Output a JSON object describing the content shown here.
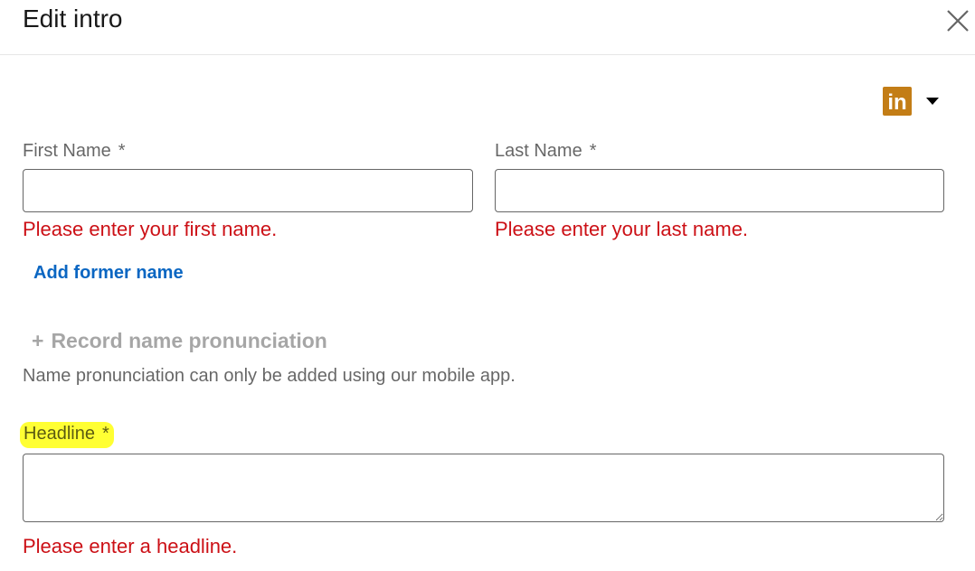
{
  "header": {
    "title": "Edit intro",
    "close_icon": "close-x-icon"
  },
  "visibility": {
    "logo_icon": "linkedin-logo-icon",
    "logo_text": "in",
    "logo_color": "#c37d16",
    "dropdown_icon": "caret-down-icon"
  },
  "first_name": {
    "label": "First Name",
    "required_mark": "*",
    "value": "",
    "error": "Please enter your first name."
  },
  "last_name": {
    "label": "Last Name",
    "required_mark": "*",
    "value": "",
    "error": "Please enter your last name."
  },
  "former_name": {
    "link": "Add former name"
  },
  "pronunciation": {
    "plus": "+",
    "button": "Record name pronunciation",
    "note": "Name pronunciation can only be added using our mobile app."
  },
  "headline": {
    "label": "Headline",
    "required_mark": "*",
    "value": "",
    "error": "Please enter a headline.",
    "highlight_color": "#ffff33"
  },
  "colors": {
    "error": "#cc1016",
    "link": "#0a66c2"
  }
}
